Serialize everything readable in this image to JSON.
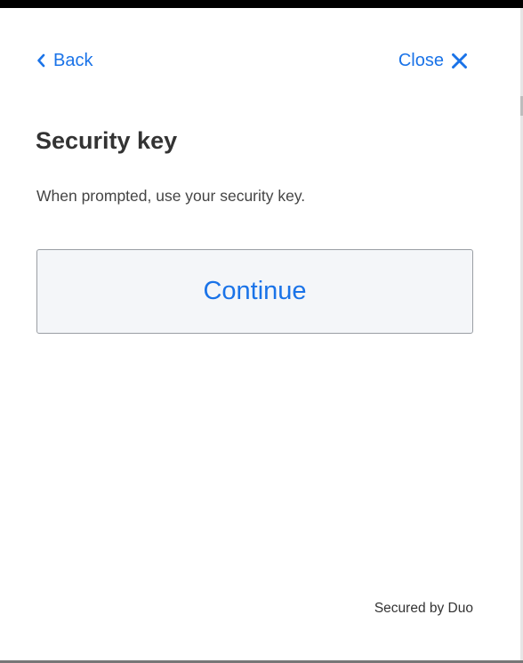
{
  "header": {
    "back_label": "Back",
    "back_icon": "chevron-left-icon",
    "close_label": "Close",
    "close_icon": "close-x-icon"
  },
  "main": {
    "title": "Security key",
    "subtitle": "When prompted, use your security key.",
    "continue_label": "Continue"
  },
  "footer": {
    "text": "Secured by Duo"
  },
  "colors": {
    "accent": "#1a73e8",
    "title_text": "#333333",
    "body_text": "#444444",
    "button_bg": "#f4f6f9",
    "button_border": "#9a9ea4"
  }
}
